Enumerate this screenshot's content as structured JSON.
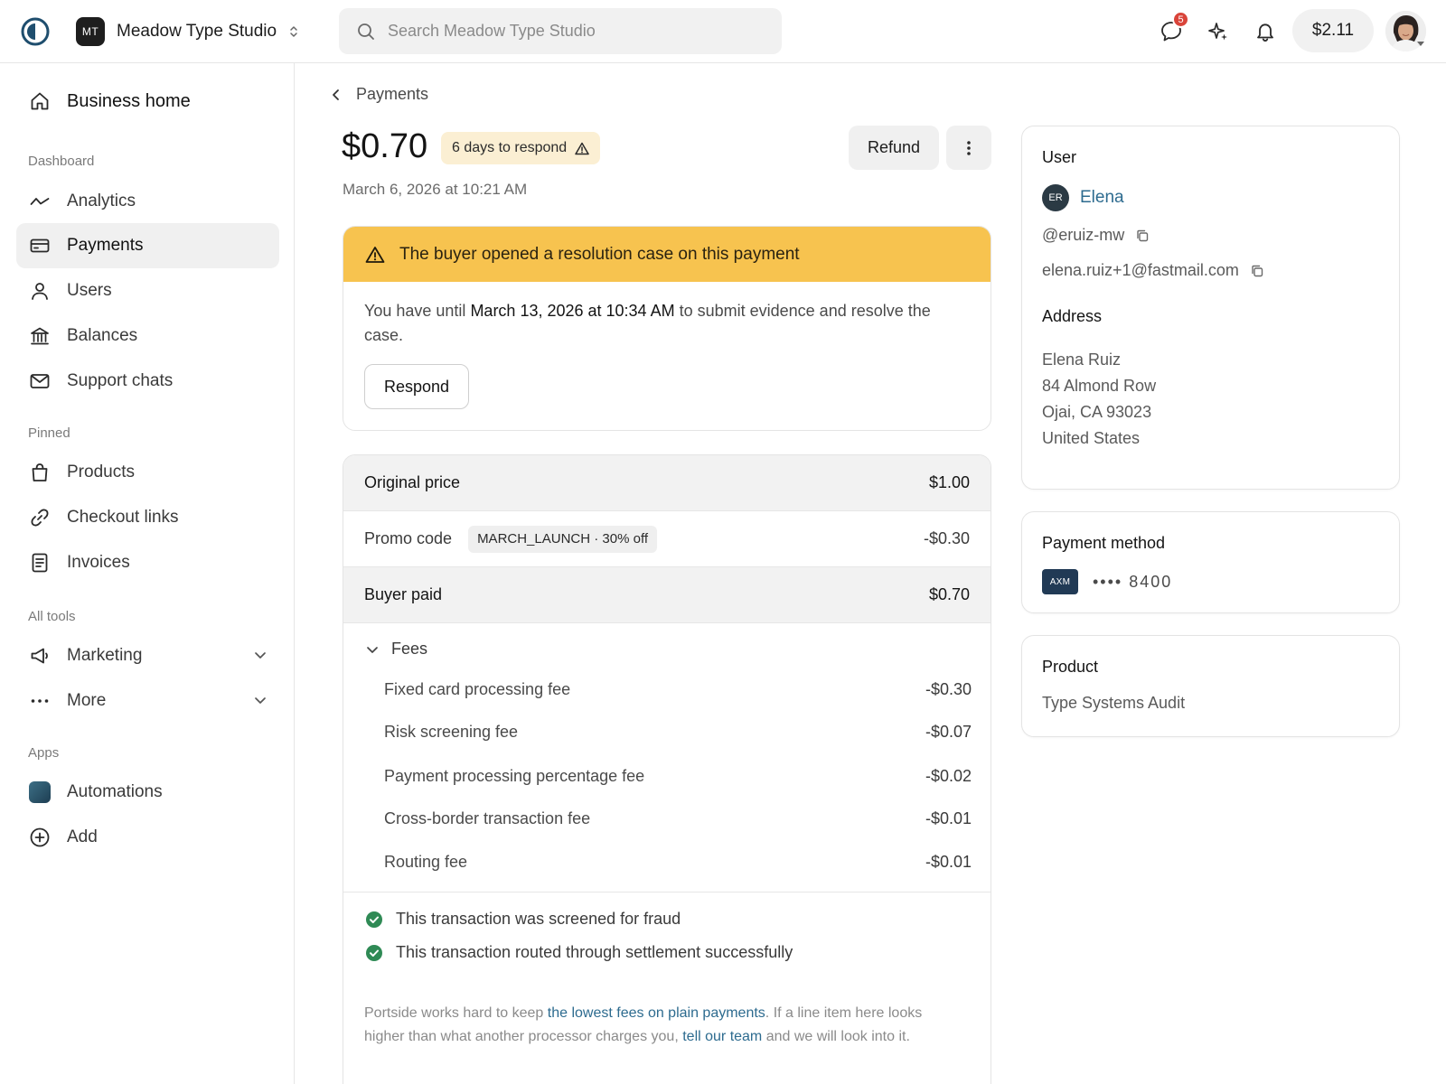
{
  "topbar": {
    "workspace_initials": "MT",
    "workspace_name": "Meadow Type Studio",
    "search_placeholder": "Search Meadow Type Studio",
    "messages_badge": "5",
    "balance": "$2.11"
  },
  "sidebar": {
    "home": "Business home",
    "sections": {
      "dashboard": "Dashboard",
      "pinned": "Pinned",
      "all_tools": "All tools",
      "apps": "Apps"
    },
    "items": [
      {
        "label": "Analytics",
        "icon": "analytics-icon"
      },
      {
        "label": "Payments",
        "icon": "card-icon",
        "active": true
      },
      {
        "label": "Users",
        "icon": "user-icon"
      },
      {
        "label": "Balances",
        "icon": "bank-icon"
      },
      {
        "label": "Support chats",
        "icon": "mail-icon"
      },
      {
        "label": "Products",
        "icon": "bag-icon"
      },
      {
        "label": "Checkout links",
        "icon": "link-icon"
      },
      {
        "label": "Invoices",
        "icon": "invoice-icon"
      },
      {
        "label": "Marketing",
        "icon": "megaphone-icon"
      },
      {
        "label": "More",
        "icon": "ellipsis-icon"
      },
      {
        "label": "Automations",
        "icon": "automations-app-icon"
      },
      {
        "label": "Add",
        "icon": "plus-circle-icon"
      }
    ]
  },
  "payment": {
    "breadcrumb": "Payments",
    "amount": "$0.70",
    "respond_badge": "6 days to respond",
    "date": "March 6, 2026 at 10:21 AM",
    "refund_label": "Refund"
  },
  "alert": {
    "title": "The buyer opened a resolution case on this payment",
    "body_pre": "You have until ",
    "body_deadline": "March 13, 2026 at 10:34 AM",
    "body_post": " to submit evidence and resolve the case.",
    "button": "Respond"
  },
  "pricing": {
    "original_label": "Original price",
    "original_value": "$1.00",
    "promo_label": "Promo code",
    "promo_tag": "MARCH_LAUNCH · 30% off",
    "promo_value": "-$0.30",
    "paid_label": "Buyer paid",
    "paid_value": "$0.70",
    "fees_label": "Fees",
    "fees": [
      {
        "label": "Fixed card processing fee",
        "value": "-$0.30"
      },
      {
        "label": "Risk screening fee",
        "value": "-$0.07"
      },
      {
        "label": "Payment processing percentage fee",
        "value": "-$0.02"
      },
      {
        "label": "Cross-border transaction fee",
        "value": "-$0.01"
      },
      {
        "label": "Routing fee",
        "value": "-$0.01"
      }
    ],
    "checks": [
      "This transaction was screened for fraud",
      "This transaction routed through settlement successfully"
    ],
    "footnote": {
      "t1": "Portside works hard to keep ",
      "link1": "the lowest fees on plain payments",
      "t2": ". If a line item here looks higher than what another processor charges you, ",
      "link2": "tell our team",
      "t3": " and we will look into it."
    }
  },
  "user_card": {
    "title": "User",
    "initials": "ER",
    "name": "Elena",
    "handle": "@eruiz-mw",
    "email": "elena.ruiz+1@fastmail.com",
    "address_title": "Address",
    "address": [
      "Elena Ruiz",
      "84 Almond Row",
      "Ojai, CA 93023",
      "United States"
    ]
  },
  "payment_method": {
    "title": "Payment method",
    "brand": "AXM",
    "number": "•••• 8400"
  },
  "product_card": {
    "title": "Product",
    "name": "Type Systems Audit"
  },
  "colors": {
    "accent_link": "#2d6b8f",
    "alert_banner": "#f7c34f",
    "badge_bg": "#fbefd3",
    "success": "#2f8a55",
    "notification": "#d9443a"
  }
}
